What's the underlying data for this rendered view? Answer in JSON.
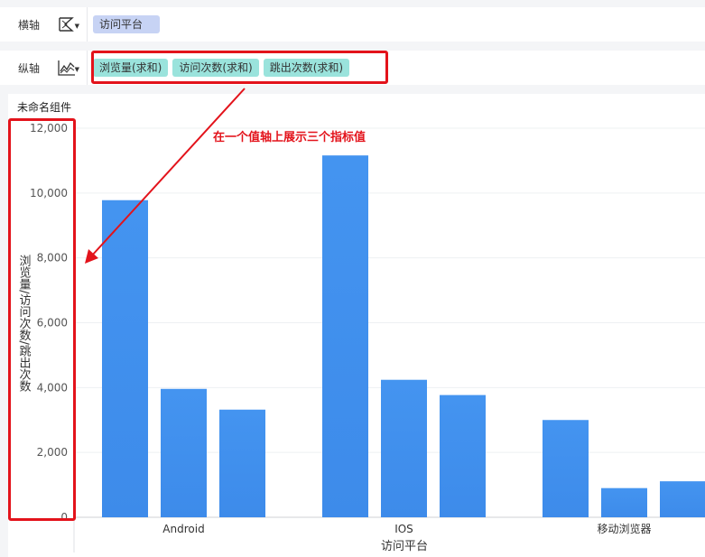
{
  "shelves": {
    "x": {
      "label": "横轴",
      "icon": "bar-type-icon",
      "fields": [
        "访问平台"
      ]
    },
    "y": {
      "label": "纵轴",
      "icon": "line-type-icon",
      "fields": [
        "浏览量(求和)",
        "访问次数(求和)",
        "跳出次数(求和)"
      ]
    }
  },
  "widget": {
    "title": "未命名组件"
  },
  "annotation": {
    "text": "在一个值轴上展示三个指标值",
    "color": "#e3131b"
  },
  "colors": {
    "bar": "#3d8bea",
    "bar_top": "#4494f0",
    "dimension_pill": "#c7d3f4",
    "measure_pill": "#9ae3dc",
    "highlight": "#e3131b"
  },
  "chart_data": {
    "type": "bar",
    "categories": [
      "Android",
      "IOS",
      "移动浏览器"
    ],
    "series": [
      {
        "values": [
          9780,
          11160,
          3000
        ]
      },
      {
        "values": [
          3960,
          4240,
          900
        ]
      },
      {
        "values": [
          3320,
          3770,
          1110
        ]
      }
    ],
    "xlabel": "访问平台",
    "ylabel": "浏览量/访问次数/跳出次数",
    "ylim": [
      0,
      12000
    ],
    "yticks": [
      0,
      2000,
      4000,
      6000,
      8000,
      10000,
      12000
    ],
    "ytick_labels": [
      "0",
      "2,000",
      "4,000",
      "6,000",
      "8,000",
      "10,000",
      "12,000"
    ],
    "grid": true,
    "legend": "none"
  }
}
